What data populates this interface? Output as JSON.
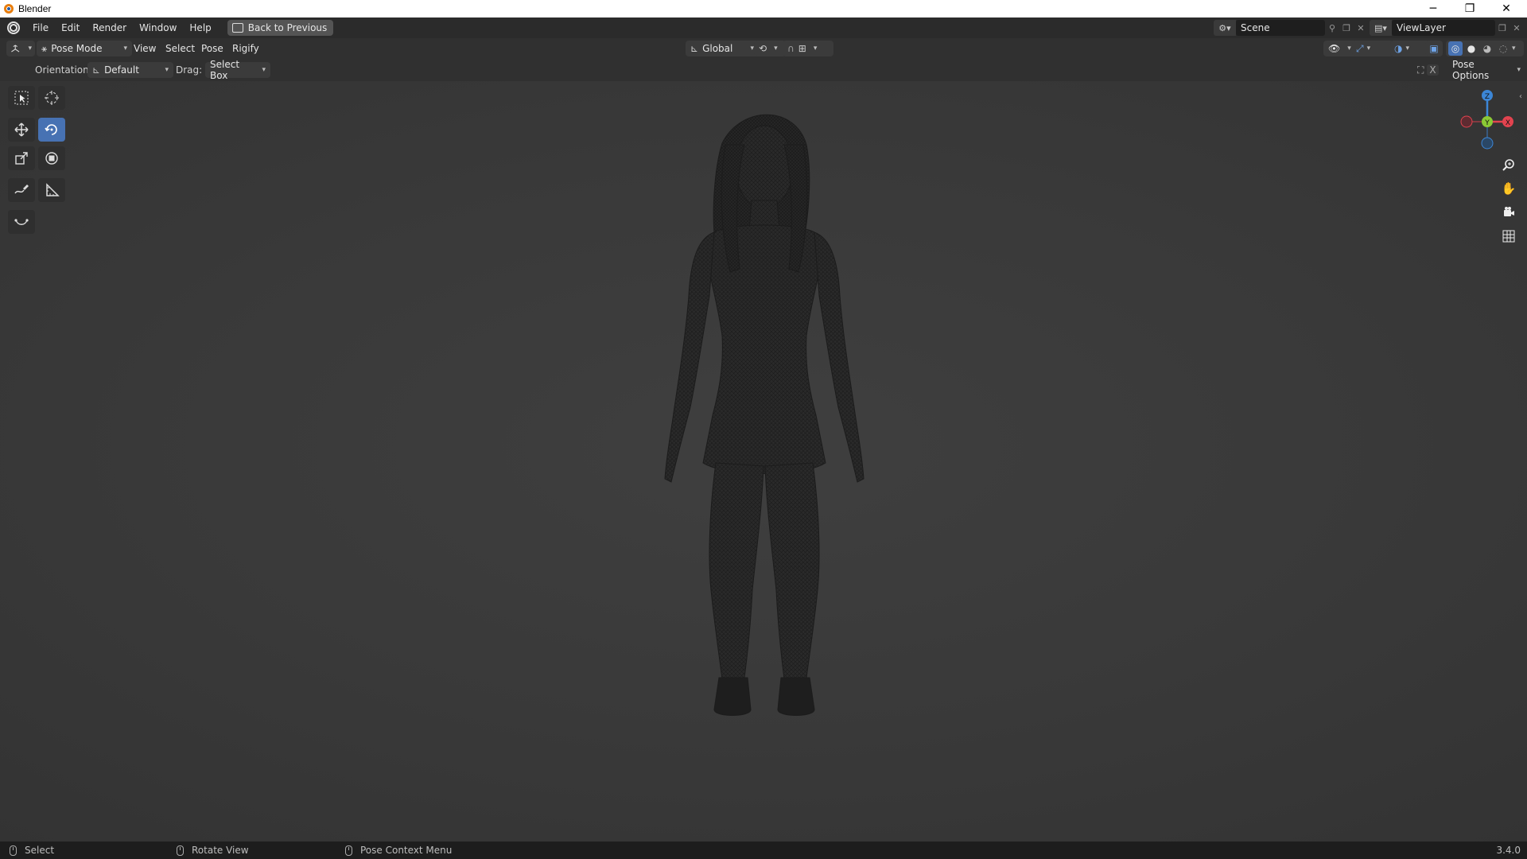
{
  "window": {
    "title": "Blender",
    "minimize": "─",
    "restore": "❐",
    "close": "✕"
  },
  "menu": {
    "items": [
      "File",
      "Edit",
      "Render",
      "Window",
      "Help"
    ],
    "back_button": "Back to Previous"
  },
  "scene": {
    "name": "Scene",
    "viewlayer": "ViewLayer"
  },
  "viewport_header": {
    "mode": "Pose Mode",
    "menus": [
      "View",
      "Select",
      "Pose",
      "Rigify"
    ],
    "transform_orientation": "Global"
  },
  "tool_settings": {
    "orientation_label": "Orientation:",
    "orientation_value": "Default",
    "drag_label": "Drag:",
    "drag_value": "Select Box",
    "pose_options": "Pose Options"
  },
  "gizmo": {
    "z": "Z",
    "y": "Y",
    "x": "X"
  },
  "status": {
    "left": "Select",
    "middle": "Rotate View",
    "right": "Pose Context Menu",
    "version": "3.4.0"
  },
  "colors": {
    "accent": "#4772b3",
    "x_axis": "#e2434f",
    "y_axis": "#8bc935",
    "z_axis": "#3c86d6"
  }
}
